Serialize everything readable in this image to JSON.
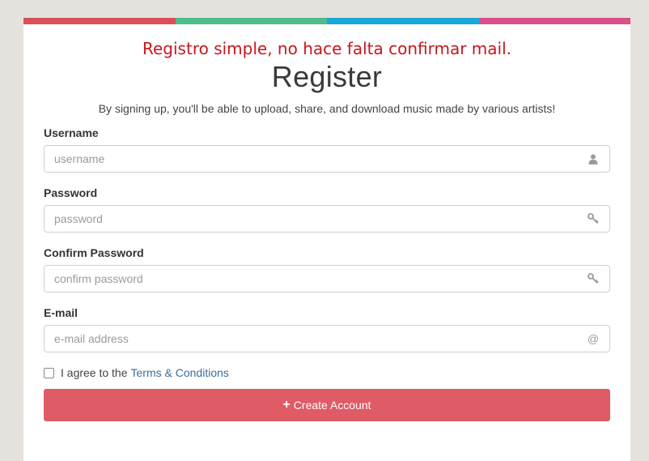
{
  "strip_colors": [
    "#d9505b",
    "#4dbd8a",
    "#1aa7d9",
    "#d9508a"
  ],
  "annotation": "Registro simple, no hace falta confirmar mail.",
  "form": {
    "title": "Register",
    "subtitle": "By signing up, you'll be able to upload, share, and download music made by various artists!",
    "fields": [
      {
        "label": "Username",
        "placeholder": "username",
        "icon": "user-icon"
      },
      {
        "label": "Password",
        "placeholder": "password",
        "icon": "key-icon"
      },
      {
        "label": "Confirm Password",
        "placeholder": "confirm password",
        "icon": "key-icon"
      },
      {
        "label": "E-mail",
        "placeholder": "e-mail address",
        "icon": "at-icon"
      }
    ],
    "terms": {
      "prefix": "I agree to the",
      "link": "Terms & Conditions",
      "checked": false
    },
    "submit_label": "Create Account",
    "submit_color": "#df5b66"
  }
}
